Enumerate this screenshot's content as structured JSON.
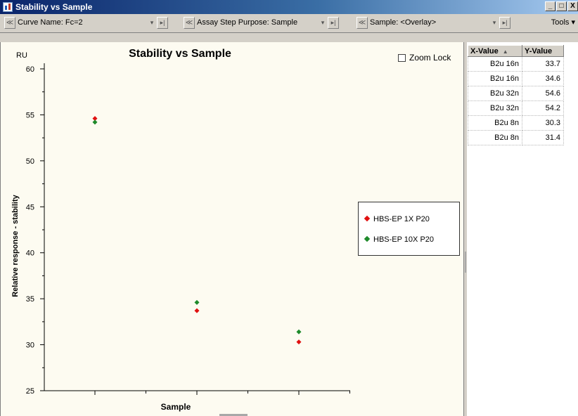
{
  "window": {
    "title": "Stability vs Sample",
    "controls": [
      "_",
      "□",
      "X"
    ]
  },
  "toolbar": {
    "curve_name": "Curve Name: Fc=2",
    "assay_step": "Assay Step Purpose: Sample",
    "sample": "Sample: <Overlay>",
    "tools_label": "Tools ▾",
    "prev_glyph": "≪",
    "next_glyph": "▸|",
    "drop_glyph": "▾"
  },
  "plot": {
    "zoom_lock_label": "Zoom Lock",
    "zoom_lock_checked": false
  },
  "chart_data": {
    "type": "scatter",
    "title": "Stability vs Sample",
    "ylabel": "Relative response - stability",
    "yunit": "RU",
    "xlabel": "Sample",
    "ylim": [
      25,
      60
    ],
    "yticks": [
      25,
      30,
      35,
      40,
      45,
      50,
      55,
      60
    ],
    "x_positions": [
      1,
      2,
      3
    ],
    "legend_position": "right",
    "series": [
      {
        "name": "HBS-EP 1X P20",
        "color": "#e01010",
        "points": [
          [
            1,
            54.6
          ],
          [
            2,
            33.7
          ],
          [
            3,
            30.3
          ]
        ]
      },
      {
        "name": "HBS-EP 10X P20",
        "color": "#1e8a2a",
        "points": [
          [
            1,
            54.2
          ],
          [
            2,
            34.6
          ],
          [
            3,
            31.4
          ]
        ]
      }
    ]
  },
  "grid": {
    "headers": {
      "x": "X-Value",
      "y": "Y-Value"
    },
    "rows": [
      {
        "x": "B2u 16n",
        "y": "33.7"
      },
      {
        "x": "B2u 16n",
        "y": "34.6"
      },
      {
        "x": "B2u 32n",
        "y": "54.6"
      },
      {
        "x": "B2u 32n",
        "y": "54.2"
      },
      {
        "x": "B2u 8n",
        "y": "30.3"
      },
      {
        "x": "B2u 8n",
        "y": "31.4"
      }
    ]
  }
}
